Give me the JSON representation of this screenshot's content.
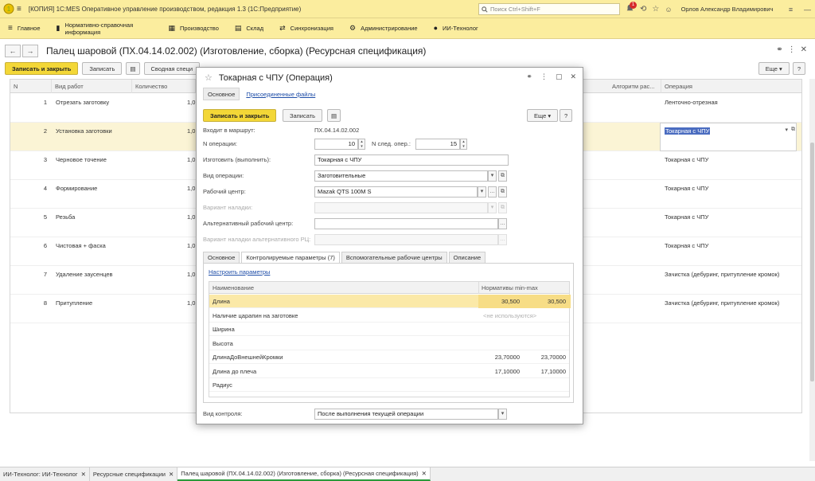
{
  "window": {
    "title": "[КОПИЯ] 1С:MES Оперативное управление производством, редакция 1.3  (1С:Предприятие)",
    "search_placeholder": "Поиск Ctrl+Shift+F",
    "notification_count": "1",
    "user": "Орлов Александр Владимирович"
  },
  "sections": [
    {
      "label": "Главное"
    },
    {
      "label": "Нормативно-справочная информация"
    },
    {
      "label": "Производство"
    },
    {
      "label": "Склад"
    },
    {
      "label": "Синхронизация"
    },
    {
      "label": "Администрирование"
    },
    {
      "label": "ИИ-Технолог"
    }
  ],
  "document": {
    "title": "Палец шаровой (ПХ.04.14.02.002) (Изготовление, сборка) (Ресурсная спецификация)",
    "save_close": "Записать и закрыть",
    "save": "Записать",
    "summary": "Сводная специ",
    "more": "Еще",
    "help": "?",
    "columns": {
      "n": "N",
      "work_type": "Вид работ",
      "quantity": "Количество",
      "algorithm": "Алгоритм рас...",
      "operation": "Операция"
    },
    "rows": [
      {
        "n": "1",
        "work": "Отрезать заготовку",
        "qty": "1,0",
        "op": "Ленточно-отрезная"
      },
      {
        "n": "2",
        "work": "Установка заготовки",
        "qty": "1,0",
        "op": "Токарная с ЧПУ"
      },
      {
        "n": "3",
        "work": "Черновое точение",
        "qty": "1,0",
        "op": "Токарная с ЧПУ"
      },
      {
        "n": "4",
        "work": "Формирование",
        "qty": "1,0",
        "op": "Токарная с ЧПУ"
      },
      {
        "n": "5",
        "work": "Резьба",
        "qty": "1,0",
        "op": "Токарная с ЧПУ"
      },
      {
        "n": "6",
        "work": "Чистовая + фаска",
        "qty": "1,0",
        "op": "Токарная с ЧПУ"
      },
      {
        "n": "7",
        "work": "Удаление заусенцев",
        "qty": "1,0",
        "op": "Зачистка (дебуринг, притупление кромок)"
      },
      {
        "n": "8",
        "work": "Притупление",
        "qty": "1,0",
        "op": "Зачистка (дебуринг, притупление кромок)"
      }
    ]
  },
  "modal": {
    "title": "Токарная с ЧПУ (Операция)",
    "tab_main": "Основное",
    "tab_files": "Присоединенные файлы",
    "save_close": "Записать и закрыть",
    "save": "Записать",
    "more": "Еще",
    "help": "?",
    "route_label": "Входит в маршрут:",
    "route_value": "ПХ.04.14.02.002",
    "op_num_label": "N операции:",
    "op_num_value": "10",
    "next_op_label": "N след. опер.:",
    "next_op_value": "15",
    "produce_label": "Изготовить (выполнить):",
    "produce_value": "Токарная с ЧПУ",
    "op_type_label": "Вид операции:",
    "op_type_value": "Заготовительные",
    "work_center_label": "Рабочий центр:",
    "work_center_value": "Mazak QTS 100M S",
    "setup_label": "Вариант наладки:",
    "alt_center_label": "Альтернативный рабочий центр:",
    "alt_setup_label": "Вариант наладки альтернативного РЦ:",
    "inner_tabs": [
      "Основное",
      "Контролируемые параметры (7)",
      "Вспомогательные рабочие центры",
      "Описание"
    ],
    "configure_link": "Настроить параметры",
    "param_columns": {
      "name": "Наименование",
      "norms": "Нормативы min-max"
    },
    "params": [
      {
        "name": "Длина",
        "min": "30,500",
        "max": "30,500",
        "hint": ""
      },
      {
        "name": "Наличие царапин на заготовке",
        "min": "",
        "max": "",
        "hint": "<не используются>"
      },
      {
        "name": "Ширина",
        "min": "",
        "max": "",
        "hint": ""
      },
      {
        "name": "Высота",
        "min": "",
        "max": "",
        "hint": ""
      },
      {
        "name": "ДлинаДоВнешнейКромки",
        "min": "23,70000",
        "max": "23,70000",
        "hint": ""
      },
      {
        "name": "Длина до плеча",
        "min": "17,10000",
        "max": "17,10000",
        "hint": ""
      },
      {
        "name": "Радиус",
        "min": "",
        "max": "",
        "hint": ""
      }
    ],
    "control_label": "Вид контроля:",
    "control_value": "После выполнения текущей операции"
  },
  "taskbar": [
    {
      "label": "ИИ-Технолог: ИИ-Технолог"
    },
    {
      "label": "Ресурсные спецификации"
    },
    {
      "label": "Палец шаровой (ПХ.04.14.02.002) (Изготовление, сборка) (Ресурсная спецификация)"
    }
  ],
  "colors": {
    "accent_yellow": "#f3d737",
    "header_bg": "#fbed9e",
    "selection": "#4a6cc0",
    "link": "#1f4ea8"
  }
}
